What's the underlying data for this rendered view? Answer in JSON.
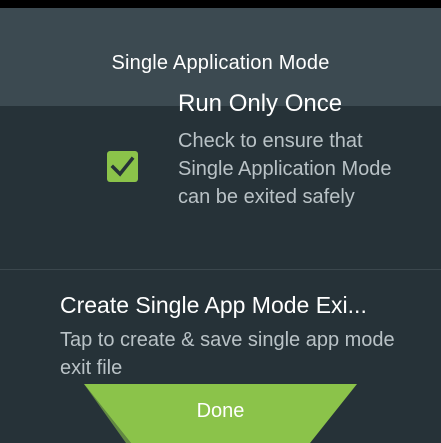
{
  "header": {
    "title": "Single Application Mode"
  },
  "preferences": [
    {
      "title": "Run Only Once",
      "summary": "Check to ensure that Single Application Mode can be exited safely",
      "checked": true
    },
    {
      "title": "Create Single App Mode Exi...",
      "summary": "Tap to create & save single app mode exit file"
    }
  ],
  "footer": {
    "done_label": "Done"
  },
  "colors": {
    "background": "#263238",
    "header": "#3c4a51",
    "accent": "#8bc34a",
    "secondary_text": "#b9c2c6"
  },
  "icons": {
    "checkbox": "check-icon"
  }
}
